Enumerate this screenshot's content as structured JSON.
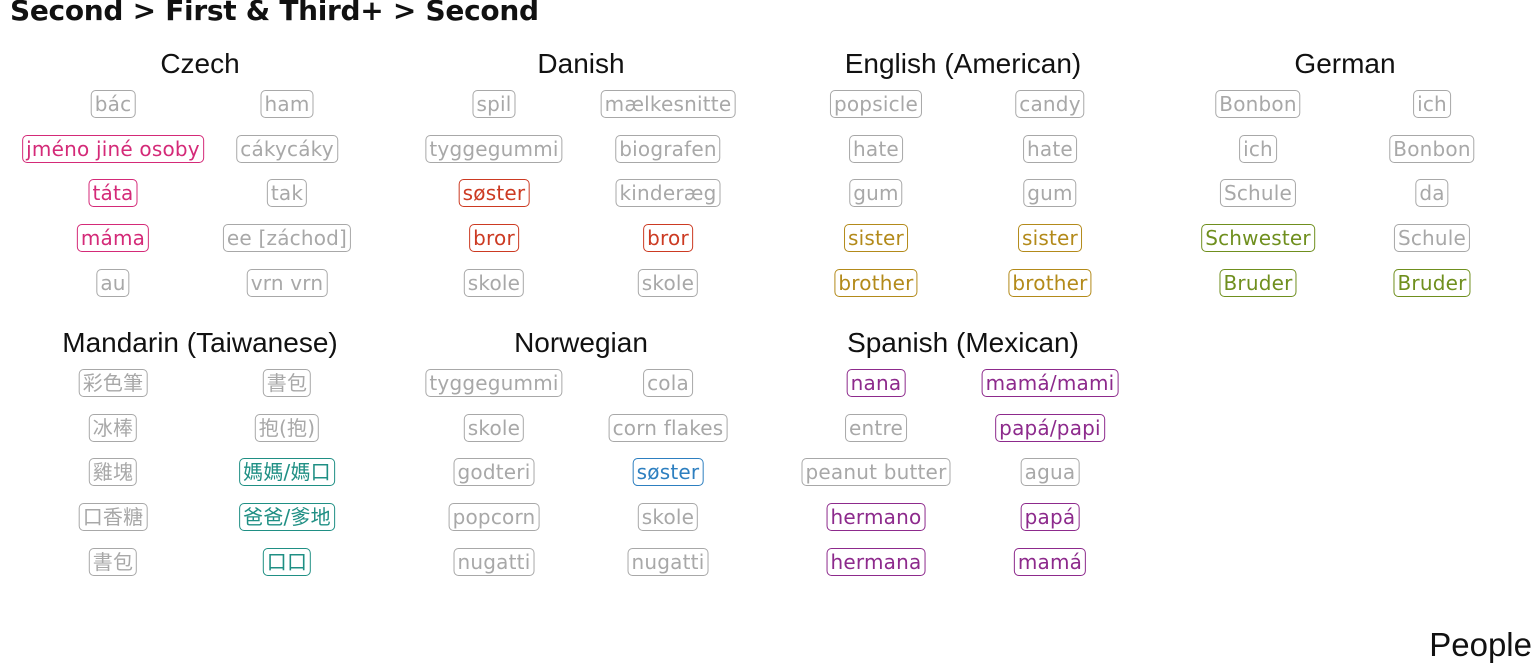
{
  "title": "Second > First & Third+ > Second",
  "footer_label": "People",
  "colors": {
    "gray": "#a8a8a8",
    "czech": "#d42a78",
    "danish": "#cc3a22",
    "english": "#b38a1a",
    "german": "#6f8f1e",
    "mandarin": "#1f8f84",
    "norwegian": "#2d7fc0",
    "spanish": "#8d2a8c"
  },
  "chart_data": {
    "type": "table",
    "panels": [
      {
        "language": "Czech",
        "colorKey": "czech",
        "rows": [
          [
            {
              "w": "bác",
              "h": false
            },
            {
              "w": "ham",
              "h": false
            }
          ],
          [
            {
              "w": "jméno jiné osoby",
              "h": true
            },
            {
              "w": "cákycáky",
              "h": false
            }
          ],
          [
            {
              "w": "táta",
              "h": true
            },
            {
              "w": "tak",
              "h": false
            }
          ],
          [
            {
              "w": "máma",
              "h": true
            },
            {
              "w": "ee [záchod]",
              "h": false
            }
          ],
          [
            {
              "w": "au",
              "h": false
            },
            {
              "w": "vrn vrn",
              "h": false
            }
          ]
        ]
      },
      {
        "language": "Danish",
        "colorKey": "danish",
        "rows": [
          [
            {
              "w": "spil",
              "h": false
            },
            {
              "w": "mælkesnitte",
              "h": false
            }
          ],
          [
            {
              "w": "tyggegummi",
              "h": false
            },
            {
              "w": "biografen",
              "h": false
            }
          ],
          [
            {
              "w": "søster",
              "h": true
            },
            {
              "w": "kinderæg",
              "h": false
            }
          ],
          [
            {
              "w": "bror",
              "h": true
            },
            {
              "w": "bror",
              "h": true
            }
          ],
          [
            {
              "w": "skole",
              "h": false
            },
            {
              "w": "skole",
              "h": false
            }
          ]
        ]
      },
      {
        "language": "English (American)",
        "colorKey": "english",
        "rows": [
          [
            {
              "w": "popsicle",
              "h": false
            },
            {
              "w": "candy",
              "h": false
            }
          ],
          [
            {
              "w": "hate",
              "h": false
            },
            {
              "w": "hate",
              "h": false
            }
          ],
          [
            {
              "w": "gum",
              "h": false
            },
            {
              "w": "gum",
              "h": false
            }
          ],
          [
            {
              "w": "sister",
              "h": true
            },
            {
              "w": "sister",
              "h": true
            }
          ],
          [
            {
              "w": "brother",
              "h": true
            },
            {
              "w": "brother",
              "h": true
            }
          ]
        ]
      },
      {
        "language": "German",
        "colorKey": "german",
        "rows": [
          [
            {
              "w": "Bonbon",
              "h": false
            },
            {
              "w": "ich",
              "h": false
            }
          ],
          [
            {
              "w": "ich",
              "h": false
            },
            {
              "w": "Bonbon",
              "h": false
            }
          ],
          [
            {
              "w": "Schule",
              "h": false
            },
            {
              "w": "da",
              "h": false
            }
          ],
          [
            {
              "w": "Schwester",
              "h": true
            },
            {
              "w": "Schule",
              "h": false
            }
          ],
          [
            {
              "w": "Bruder",
              "h": true
            },
            {
              "w": "Bruder",
              "h": true
            }
          ]
        ]
      },
      {
        "language": "Mandarin (Taiwanese)",
        "colorKey": "mandarin",
        "rows": [
          [
            {
              "w": "彩色筆",
              "h": false
            },
            {
              "w": "書包",
              "h": false
            }
          ],
          [
            {
              "w": "冰棒",
              "h": false
            },
            {
              "w": "抱(抱)",
              "h": false
            }
          ],
          [
            {
              "w": "雞塊",
              "h": false
            },
            {
              "w": "媽媽/媽口",
              "h": true
            }
          ],
          [
            {
              "w": "口香糖",
              "h": false
            },
            {
              "w": "爸爸/爹地",
              "h": true
            }
          ],
          [
            {
              "w": "書包",
              "h": false
            },
            {
              "w": "口口",
              "h": true
            }
          ]
        ]
      },
      {
        "language": "Norwegian",
        "colorKey": "norwegian",
        "rows": [
          [
            {
              "w": "tyggegummi",
              "h": false
            },
            {
              "w": "cola",
              "h": false
            }
          ],
          [
            {
              "w": "skole",
              "h": false
            },
            {
              "w": "corn flakes",
              "h": false
            }
          ],
          [
            {
              "w": "godteri",
              "h": false
            },
            {
              "w": "søster",
              "h": true
            }
          ],
          [
            {
              "w": "popcorn",
              "h": false
            },
            {
              "w": "skole",
              "h": false
            }
          ],
          [
            {
              "w": "nugatti",
              "h": false
            },
            {
              "w": "nugatti",
              "h": false
            }
          ]
        ]
      },
      {
        "language": "Spanish (Mexican)",
        "colorKey": "spanish",
        "rows": [
          [
            {
              "w": "nana",
              "h": true
            },
            {
              "w": "mamá/mami",
              "h": true
            }
          ],
          [
            {
              "w": "entre",
              "h": false
            },
            {
              "w": "papá/papi",
              "h": true
            }
          ],
          [
            {
              "w": "peanut butter",
              "h": false
            },
            {
              "w": "agua",
              "h": false
            }
          ],
          [
            {
              "w": "hermano",
              "h": true
            },
            {
              "w": "papá",
              "h": true
            }
          ],
          [
            {
              "w": "hermana",
              "h": true
            },
            {
              "w": "mamá",
              "h": true
            }
          ]
        ]
      }
    ]
  }
}
